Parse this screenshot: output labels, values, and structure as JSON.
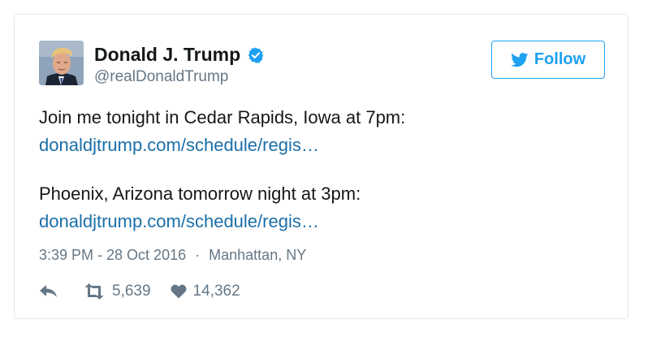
{
  "profile": {
    "name": "Donald J. Trump",
    "handle": "@realDonaldTrump",
    "verified": true
  },
  "follow_button": {
    "label": "Follow",
    "icon": "twitter-bird-icon"
  },
  "tweet": {
    "line1": "Join me tonight in Cedar Rapids, Iowa at 7pm:",
    "link1": "donaldjtrump.com/schedule/regis…",
    "line2": "Phoenix, Arizona tomorrow night at 3pm:",
    "link2": "donaldjtrump.com/schedule/regis…"
  },
  "meta": {
    "timestamp": "3:39 PM - 28 Oct 2016",
    "separator": "·",
    "location": "Manhattan, NY"
  },
  "actions": {
    "reply_icon": "reply-icon",
    "retweet_icon": "retweet-icon",
    "retweet_count": "5,639",
    "like_icon": "heart-icon",
    "like_count": "14,362"
  },
  "colors": {
    "link": "#1b6fa8",
    "twitter_blue": "#1da1f2",
    "muted": "#657786",
    "border": "#e1e8ed"
  }
}
